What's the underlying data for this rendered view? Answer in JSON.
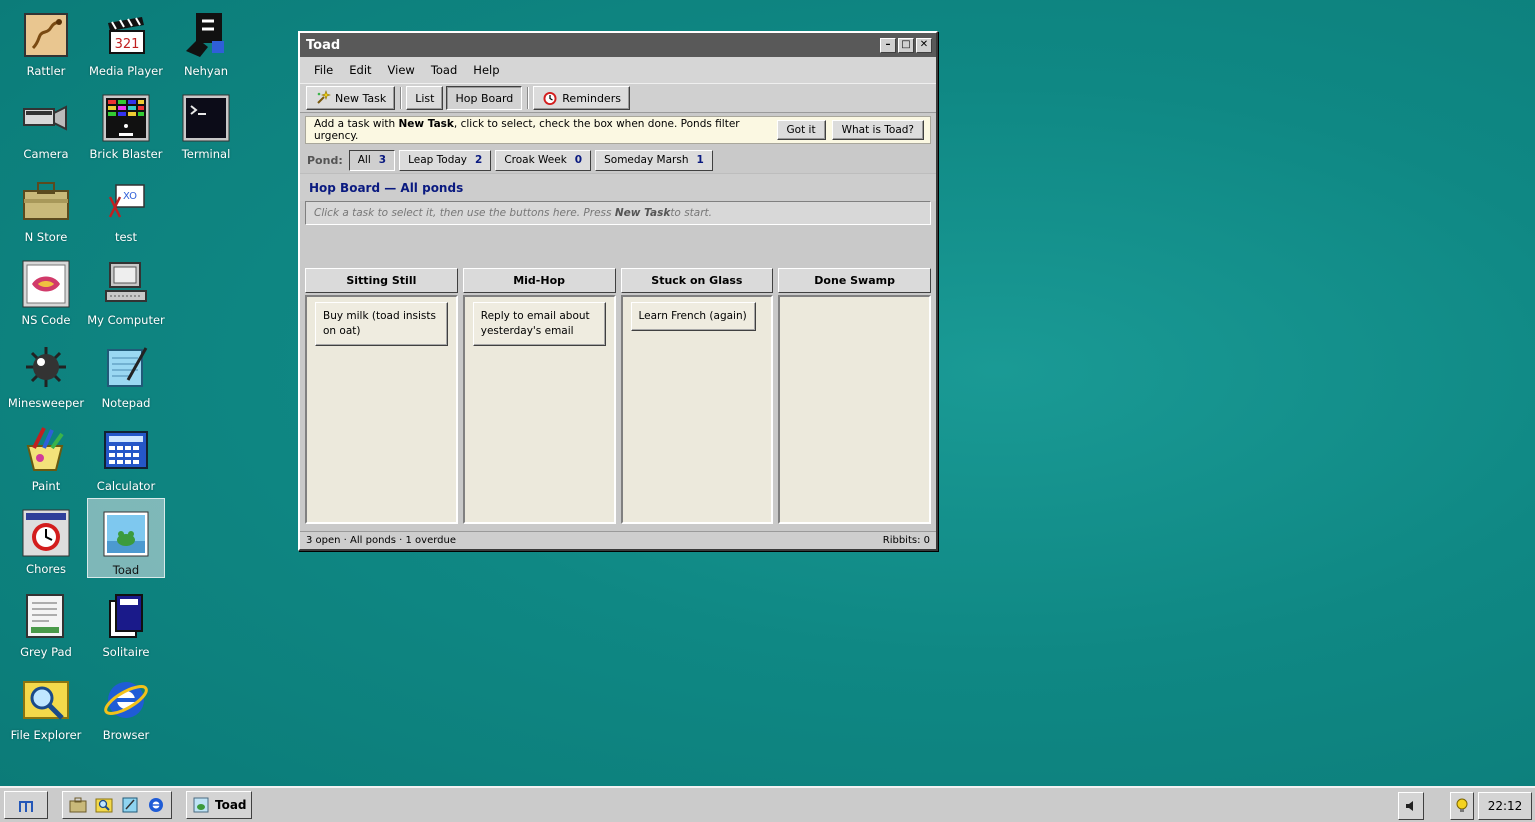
{
  "desktop": {
    "icons": [
      {
        "label": "Rattler",
        "icon": "rattler-icon"
      },
      {
        "label": "Media Player",
        "icon": "media-player-icon"
      },
      {
        "label": "Nehyan",
        "icon": "nehyan-icon"
      },
      {
        "label": "Camera",
        "icon": "camera-icon"
      },
      {
        "label": "Brick Blaster",
        "icon": "brick-blaster-icon"
      },
      {
        "label": "Terminal",
        "icon": "terminal-icon"
      },
      {
        "label": "N Store",
        "icon": "store-icon"
      },
      {
        "label": "test",
        "icon": "test-icon"
      },
      {
        "label": "NS Code",
        "icon": "code-icon"
      },
      {
        "label": "My Computer",
        "icon": "computer-icon"
      },
      {
        "label": "Minesweeper",
        "icon": "minesweeper-icon"
      },
      {
        "label": "Notepad",
        "icon": "notepad-icon"
      },
      {
        "label": "Paint",
        "icon": "paint-icon"
      },
      {
        "label": "Calculator",
        "icon": "calculator-icon"
      },
      {
        "label": "Chores",
        "icon": "chores-icon"
      },
      {
        "label": "Toad",
        "icon": "toad-icon",
        "selected": true
      },
      {
        "label": "Grey Pad",
        "icon": "grey-pad-icon"
      },
      {
        "label": "Solitaire",
        "icon": "solitaire-icon"
      },
      {
        "label": "File Explorer",
        "icon": "file-explorer-icon"
      },
      {
        "label": "Browser",
        "icon": "browser-icon"
      }
    ]
  },
  "window": {
    "title": "Toad",
    "controls": {
      "minimize": "–",
      "maximize": "□",
      "close": "✕"
    },
    "menu": [
      "File",
      "Edit",
      "View",
      "Toad",
      "Help"
    ],
    "toolbar": {
      "new_task": "New Task",
      "list": "List",
      "hop_board": "Hop Board",
      "reminders": "Reminders"
    },
    "tip": {
      "prefix": "Add a task with ",
      "strong": "New Task",
      "suffix": ", click to select, check the box when done. Ponds filter urgency.",
      "got_it": "Got it",
      "what_is": "What is Toad?"
    },
    "ponds": {
      "label": "Pond:",
      "items": [
        {
          "name": "All",
          "count": "3",
          "active": true
        },
        {
          "name": "Leap Today",
          "count": "2"
        },
        {
          "name": "Croak Week",
          "count": "0"
        },
        {
          "name": "Someday Marsh",
          "count": "1"
        }
      ]
    },
    "board_title": "Hop Board — All ponds",
    "hint": {
      "prefix": "Click a task to select it, then use the buttons here. Press ",
      "strong": "New Task",
      "suffix": " to start."
    },
    "columns": [
      {
        "title": "Sitting Still",
        "cards": [
          "Buy milk (toad insists on oat)"
        ]
      },
      {
        "title": "Mid-Hop",
        "cards": [
          "Reply to email about yesterday's email"
        ]
      },
      {
        "title": "Stuck on Glass",
        "cards": [
          "Learn French (again)"
        ]
      },
      {
        "title": "Done Swamp",
        "cards": []
      }
    ],
    "status": {
      "left": "3 open · All ponds · 1 overdue",
      "right": "Ribbits: 0"
    }
  },
  "taskbar": {
    "quick_launch": [
      "store-icon",
      "file-explorer-icon",
      "notepad-icon",
      "browser-icon"
    ],
    "task": "Toad",
    "clock": "22:12"
  },
  "colors": {
    "desktop": "#0f8884",
    "titlebar": "#595959",
    "accent_text": "#0a1a80",
    "column_body": "#ece9dc",
    "tip_background": "#fbf8e2"
  }
}
